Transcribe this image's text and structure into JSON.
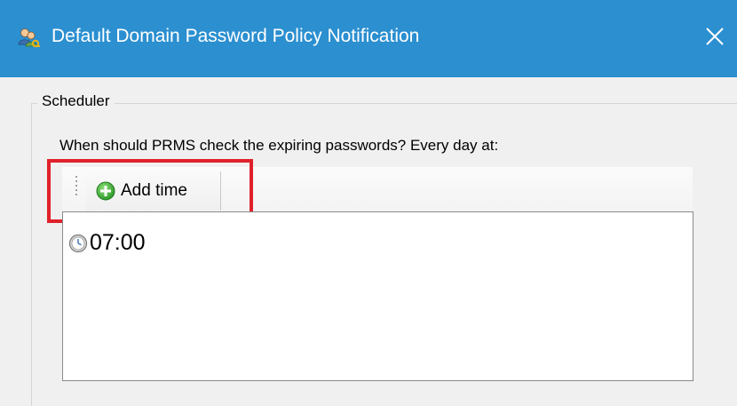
{
  "window": {
    "title": "Default Domain Password Policy Notification",
    "title_icon": "users-key-icon",
    "close_glyph": "✕",
    "accent_color": "#2b8fd0"
  },
  "scheduler": {
    "group_label": "Scheduler",
    "question": "When should PRMS check the expiring passwords? Every day at:",
    "toolbar": {
      "add_time_label": "Add time",
      "add_time_icon": "plus-circle-icon"
    },
    "times": [
      {
        "label": "07:00",
        "icon": "clock-icon"
      }
    ]
  },
  "annotation": {
    "highlight_color": "#e0212b"
  }
}
